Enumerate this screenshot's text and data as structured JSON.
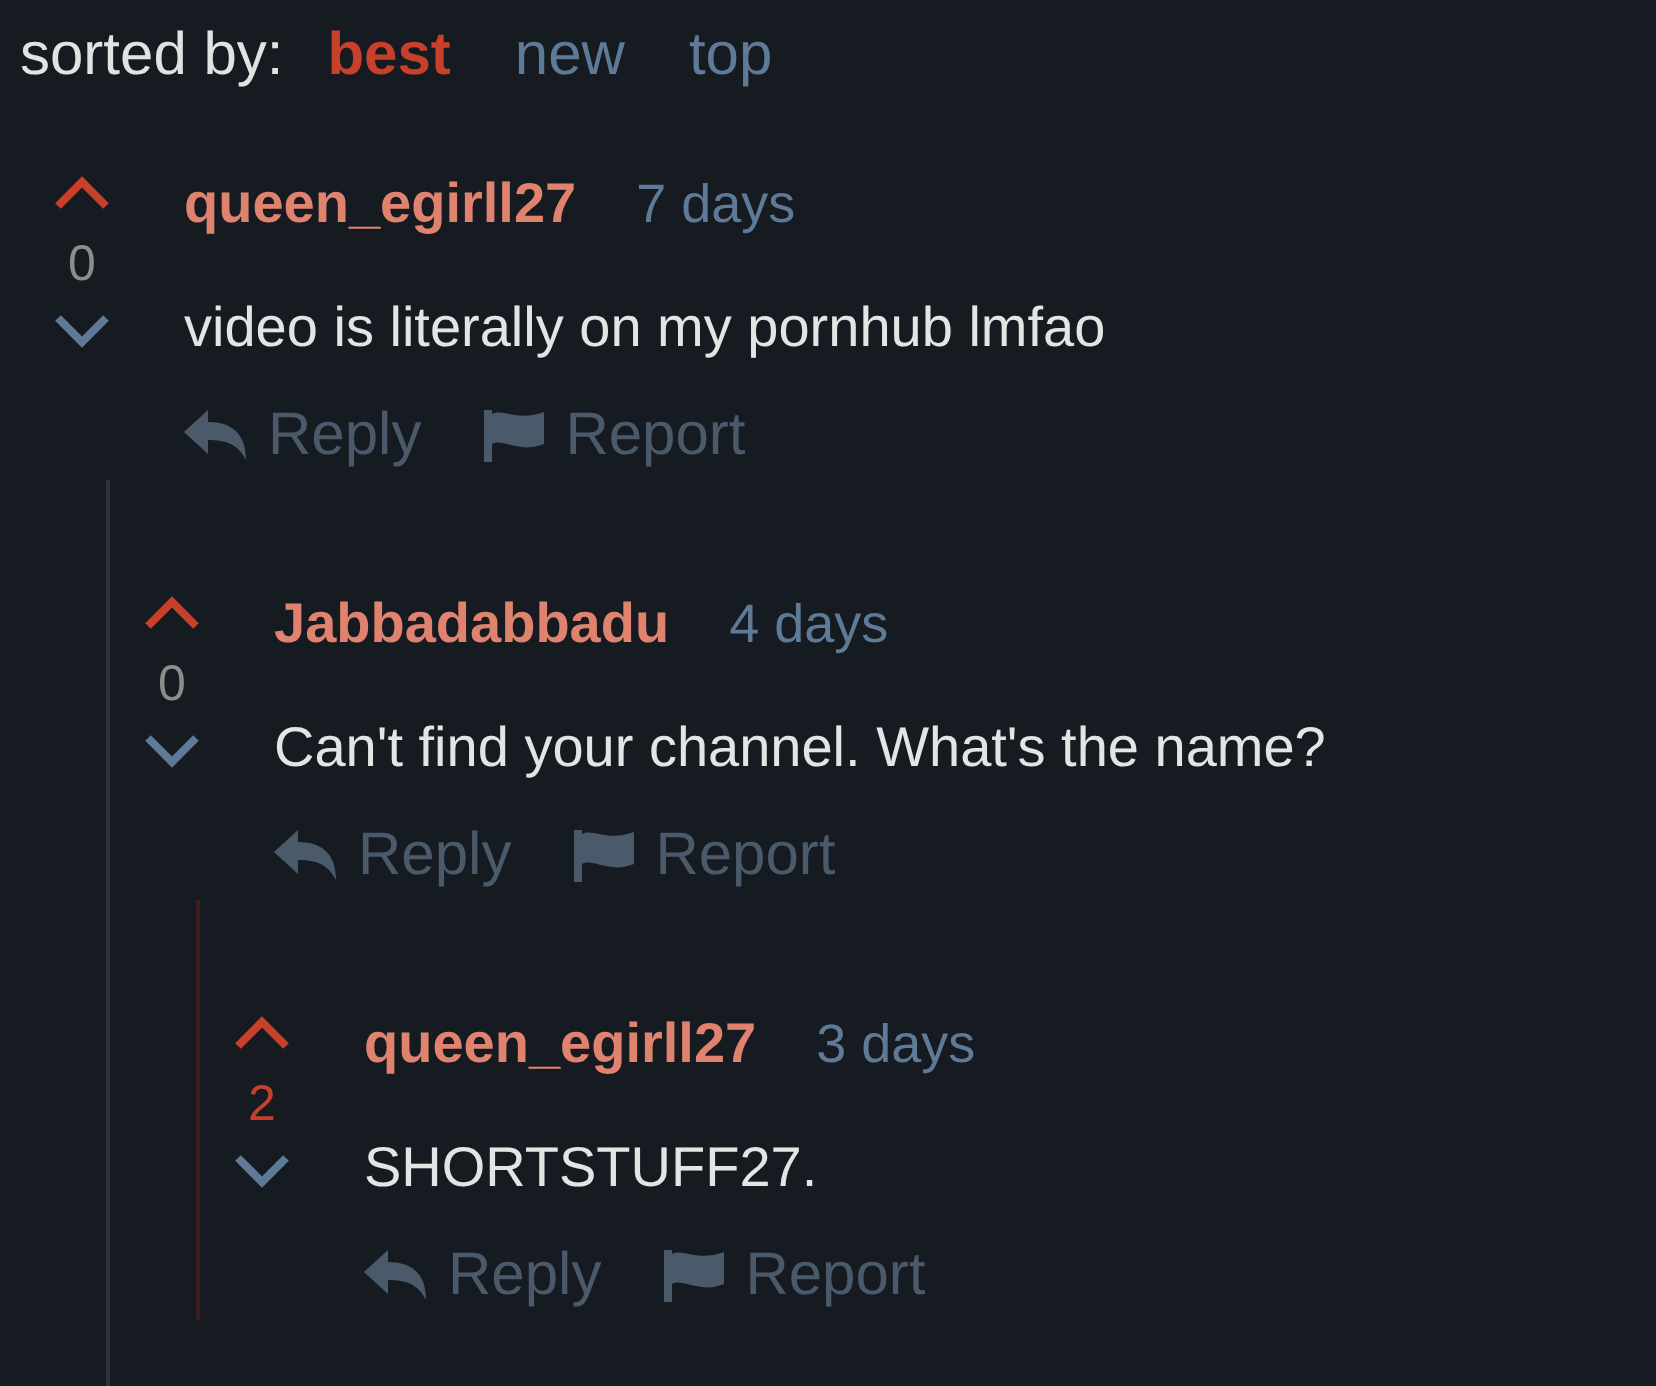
{
  "sort": {
    "label": "sorted by:",
    "options": [
      {
        "label": "best",
        "selected": true
      },
      {
        "label": "new",
        "selected": false
      },
      {
        "label": "top",
        "selected": false
      }
    ]
  },
  "comments": [
    {
      "author": "queen_egirll27",
      "time": "7 days",
      "score": "0",
      "upvoted": false,
      "body": "video is literally on my pornhub lmfao",
      "actions": [
        "Reply",
        "Report"
      ],
      "children": [
        {
          "author": "Jabbadabbadu",
          "time": "4 days",
          "score": "0",
          "upvoted": false,
          "body": "Can't find your channel. What's the name?",
          "actions": [
            "Reply",
            "Report"
          ],
          "children": [
            {
              "author": "queen_egirll27",
              "time": "3 days",
              "score": "2",
              "upvoted": true,
              "body": "SHORTSTUFF27.",
              "actions": [
                "Reply",
                "Report"
              ]
            }
          ]
        }
      ]
    }
  ]
}
